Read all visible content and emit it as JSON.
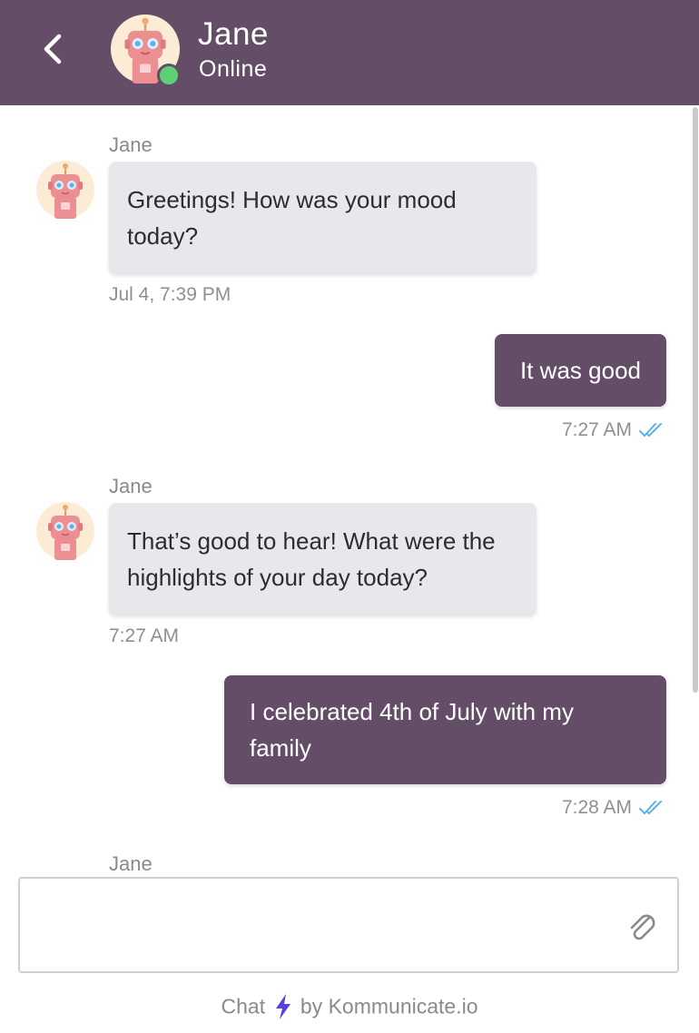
{
  "header": {
    "name": "Jane",
    "status": "Online",
    "colors": {
      "background": "#644e67",
      "online_dot": "#5fd07a"
    },
    "icons": {
      "back": "chevron-left-icon",
      "avatar": "robot-avatar"
    }
  },
  "messages": [
    {
      "direction": "in",
      "sender": "Jane",
      "text": "Greetings! How was your mood today?",
      "time": "Jul 4, 7:39 PM"
    },
    {
      "direction": "out",
      "text": "It was good",
      "time": "7:27 AM",
      "status_icon": "double-check-icon"
    },
    {
      "direction": "in",
      "sender": "Jane",
      "text": "That’s good to hear! What were the highlights of your day today?",
      "time": "7:27 AM"
    },
    {
      "direction": "out",
      "text": "I celebrated 4th of July with my family",
      "time": "7:28 AM",
      "status_icon": "double-check-icon"
    },
    {
      "direction": "in",
      "sender": "Jane"
    }
  ],
  "composer": {
    "value": "",
    "placeholder": "",
    "attach_icon": "paperclip-icon"
  },
  "footer": {
    "prefix": "Chat",
    "icon": "lightning-bolt-icon",
    "suffix": "by Kommunicate.io"
  },
  "colors": {
    "incoming_bubble": "#e8e8ec",
    "outgoing_bubble": "#644e67",
    "read_receipt": "#5ab3e6",
    "bolt": "#5a3fd8"
  }
}
